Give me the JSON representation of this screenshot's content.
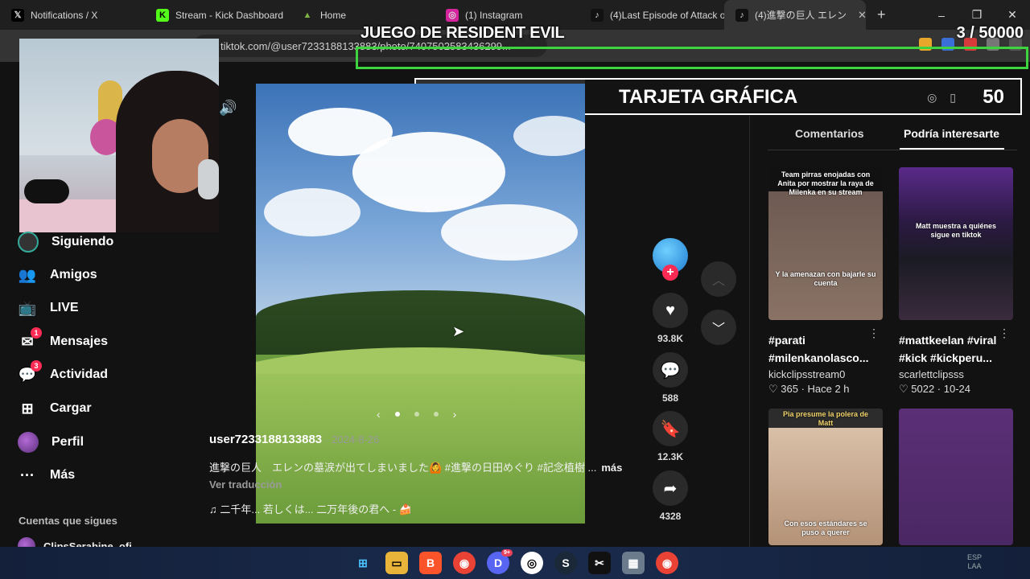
{
  "browser": {
    "tabs": [
      {
        "label": "Notifications / X",
        "fav": "𝕏",
        "color": "#000000"
      },
      {
        "label": "Stream - Kick Dashboard",
        "fav": "K",
        "color": "#53fc18"
      },
      {
        "label": "Home",
        "fav": "▲",
        "color": "#2e7d32"
      },
      {
        "label": "(1) Instagram",
        "fav": "◎",
        "color": "#d6249f"
      },
      {
        "label": "(4)Last Episode of Attack o",
        "fav": "♪",
        "color": "#111111"
      },
      {
        "label": "(4)進撃の巨人 エレン",
        "fav": "♪",
        "color": "#111111"
      }
    ],
    "new_tab": "+",
    "window_controls": [
      "–",
      "❐",
      "✕"
    ],
    "url": "tiktok.com/@user7233188133883/photo/7407502583436299..."
  },
  "overlay": {
    "goal1_title": "JUEGO DE RESIDENT EVIL",
    "goal1_count": "3  / 50000",
    "goal1_progress": 6e-05,
    "goal2_left": "0",
    "goal2_title": "TARJETA GRÁFICA",
    "goal2_right": "50",
    "goal2_progress": 0
  },
  "sidebar": {
    "items": [
      {
        "label": "Siguiendo",
        "icon": "following-avatar-icon"
      },
      {
        "label": "Amigos",
        "icon": "friends-icon",
        "glyph": "👥"
      },
      {
        "label": "LIVE",
        "icon": "live-icon",
        "glyph": "📺"
      },
      {
        "label": "Mensajes",
        "icon": "messages-icon",
        "glyph": "✉",
        "badge": "1"
      },
      {
        "label": "Actividad",
        "icon": "activity-icon",
        "glyph": "💬",
        "badge": "3"
      },
      {
        "label": "Cargar",
        "icon": "upload-icon",
        "glyph": "⊞"
      },
      {
        "label": "Perfil",
        "icon": "profile-avatar-icon"
      },
      {
        "label": "Más",
        "icon": "more-icon",
        "glyph": "···"
      }
    ],
    "section_title": "Cuentas que sigues",
    "following_account": "ClipsSerabine_ofi"
  },
  "post": {
    "author": "user7233188133883",
    "date": "· 2024-8-26",
    "caption": "進撃の巨人　エレンの墓涙が出てしまいました🙆 #進撃の日田めぐり #記念植樹 ...",
    "more": "más",
    "translate": "Ver traducción",
    "music": "♫  二千年... 若しくは... 二万年後の君へ - 🍰"
  },
  "actions": {
    "likes": "93.8K",
    "comments": "588",
    "saves": "12.3K",
    "shares": "4328"
  },
  "panel": {
    "tabs": [
      "Comentarios",
      "Podría interesarte"
    ],
    "cards": [
      {
        "title": "#parati #milenkanolasco...",
        "user": "kickclipsstream0",
        "meta": "♡ 365 · Hace 2 h",
        "thumb_top": "Team pirras enojadas con Anita por mostrar la raya de Milenka en su stream",
        "thumb_bottom": "Y la amenazan con bajarle su cuenta"
      },
      {
        "title": "#mattkeelan #viral #kick #kickperu...",
        "user": "scarlettclipsss",
        "meta": "♡ 5022 · 10-24",
        "thumb_top": "Matt muestra a quiénes sigue en tiktok",
        "thumb_bottom": ""
      },
      {
        "title": "",
        "user": "",
        "meta": "",
        "thumb_top": "Pia presume la polera de Matt",
        "thumb_bottom": "Con esos estándares se puso a querer"
      },
      {
        "title": "",
        "user": "",
        "meta": "",
        "thumb_top": "",
        "thumb_bottom": ""
      }
    ]
  },
  "taskbar": [
    "start-icon",
    "explorer-icon",
    "brave-icon",
    "chrome-icon",
    "discord-icon",
    "obs-icon",
    "steam-icon",
    "capcut-icon",
    "calculator-icon",
    "chrome-icon"
  ],
  "tray": {
    "lang": "ESP",
    "layout": "LAA"
  }
}
